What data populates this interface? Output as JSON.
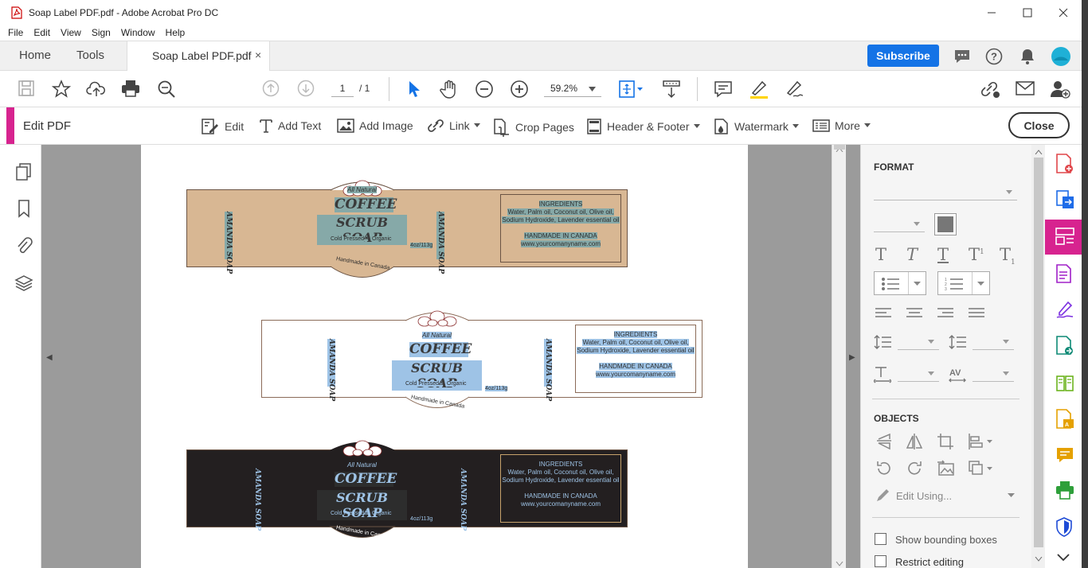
{
  "window": {
    "title": "Soap Label PDF.pdf - Adobe Acrobat Pro DC"
  },
  "menu": [
    "File",
    "Edit",
    "View",
    "Sign",
    "Window",
    "Help"
  ],
  "tabs": {
    "home": "Home",
    "tools": "Tools",
    "document": "Soap Label PDF.pdf",
    "close": "×"
  },
  "subscribe": "Subscribe",
  "toolbar": {
    "page_current": "1",
    "page_total": "/ 1",
    "zoom": "59.2%"
  },
  "editbar": {
    "title": "Edit PDF",
    "items": [
      "Edit",
      "Add Text",
      "Add Image",
      "Link",
      "Crop Pages",
      "Header & Footer",
      "Watermark",
      "More"
    ],
    "close": "Close"
  },
  "labels": {
    "all_natural": "All Natural",
    "line1": "COFFEE",
    "line2": "SCRUB SOAP",
    "brand": "AMANDA SOAP",
    "cold_pressed": "Cold Pressed",
    "organic": "Organic",
    "weight": "4oz/113g",
    "handmade": "Handmade in Canada",
    "ingredients_title": "INGREDIENTS",
    "ingredients_1": "Water, Palm oil, Coconut oil, Olive oil,",
    "ingredients_2": "Sodium Hydroxide, Lavender essential oil",
    "made_in": "HANDMADE IN CANADA",
    "website": "www.yourcomanyname.com"
  },
  "format_panel": {
    "format_heading": "FORMAT",
    "objects_heading": "OBJECTS",
    "edit_using": "Edit Using...",
    "show_bounding": "Show bounding boxes",
    "restrict_editing": "Restrict editing"
  },
  "colors": {
    "accent": "#d7238f",
    "subscribe": "#1473e6",
    "label_tan": "#d8b793",
    "label_dark": "#231f20",
    "highlight": "#9ec3e6"
  }
}
